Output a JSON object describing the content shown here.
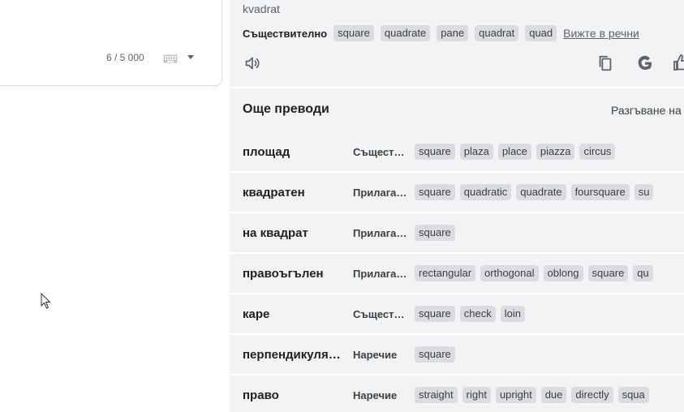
{
  "source": {
    "char_count": "6 / 5 000",
    "keyboard_icon": "keyboard-icon",
    "dropdown_icon": "chevron-down-icon"
  },
  "result": {
    "transliteration": "kvadrat",
    "part_of_speech": "Съществително",
    "alternatives": [
      "square",
      "quadrate",
      "pane",
      "quadrat",
      "quad"
    ],
    "dictionary_link": "Вижте в речни"
  },
  "toolbar": {
    "listen_icon": "speaker-icon",
    "copy_icon": "copy-icon",
    "google_icon": "google-icon",
    "rate_icon": "thumbs-up-icon"
  },
  "more": {
    "title": "Още преводи",
    "expand_label": "Разгъване на",
    "rows": [
      {
        "term": "площад",
        "pos": "Съществително",
        "synonyms": [
          "square",
          "plaza",
          "place",
          "piazza",
          "circus"
        ]
      },
      {
        "term": "квадратен",
        "pos": "Прилагателно",
        "synonyms": [
          "square",
          "quadratic",
          "quadrate",
          "foursquare",
          "su"
        ]
      },
      {
        "term": "на квадрат",
        "pos": "Прилагателно",
        "synonyms": [
          "square"
        ]
      },
      {
        "term": "правоъгълен",
        "pos": "Прилагателно",
        "synonyms": [
          "rectangular",
          "orthogonal",
          "oblong",
          "square",
          "qu"
        ]
      },
      {
        "term": "каре",
        "pos": "Съществително",
        "synonyms": [
          "square",
          "check",
          "loin"
        ]
      },
      {
        "term": "перпендикулярен",
        "pos": "Наречие",
        "synonyms": [
          "square"
        ]
      },
      {
        "term": "право",
        "pos": "Наречие",
        "synonyms": [
          "straight",
          "right",
          "upright",
          "due",
          "directly",
          "squa"
        ]
      }
    ]
  },
  "colors": {
    "panel_bg": "#f1f3f4",
    "chip_bg": "#dadce0",
    "text_primary": "#202124",
    "text_secondary": "#5f6368"
  }
}
